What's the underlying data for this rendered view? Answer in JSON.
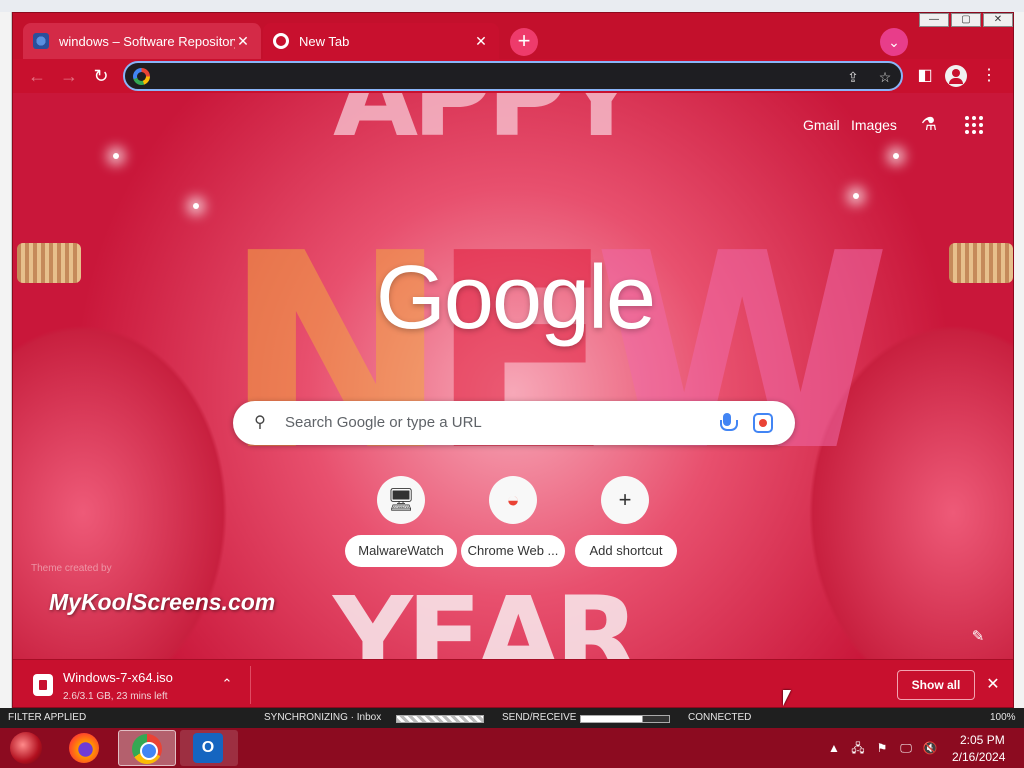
{
  "browser": {
    "tabs": [
      {
        "title": "windows – Software Repository",
        "close": "✕"
      },
      {
        "title": "New Tab",
        "close": "✕"
      }
    ],
    "new_tab_symbol": "+",
    "tab_search_symbol": "⌄",
    "window_controls": {
      "minimize": "—",
      "maximize": "▢",
      "close": "✕"
    },
    "toolbar": {
      "back": "←",
      "forward": "→",
      "reload": "↻",
      "address_value": "",
      "share_icon": "⇪",
      "bookmark_icon": "☆",
      "side_panel_icon": "◧",
      "menu_icon": "⋮"
    }
  },
  "ntp": {
    "top_links": {
      "gmail": "Gmail",
      "images": "Images"
    },
    "labs_icon": "⚗",
    "logo": "Google",
    "search_placeholder": "Search Google or type a URL",
    "search_icon": "⚲",
    "shortcuts": [
      {
        "label": "MalwareWatch",
        "icon": "🖥"
      },
      {
        "label": "Chrome Web ...",
        "icon": "◒"
      },
      {
        "label": "Add shortcut",
        "icon": "+"
      }
    ],
    "background_art": {
      "top": "APPY",
      "middle": [
        "N",
        "E",
        "W"
      ],
      "bottom": "YEAR"
    },
    "attribution": "Theme created by",
    "watermark": "MyKoolScreens.com",
    "customize_icon": "✎"
  },
  "download": {
    "file_name": "Windows-7-x64.iso",
    "status": "2.6/3.1 GB, 23 mins left",
    "chevron": "⌃",
    "show_all": "Show all",
    "close": "✕"
  },
  "outlook_status": {
    "filter": "FILTER APPLIED",
    "sync": "SYNCHRONIZING · Inbox",
    "send_receive": "SEND/RECEIVE",
    "connection": "CONNECTED",
    "zoom": "100%"
  },
  "taskbar": {
    "time": "2:05 PM",
    "date": "2/16/2024",
    "outlook_icon_letter": "O",
    "tray": {
      "chevron": "▲",
      "network": "🖧",
      "flag": "⚑",
      "monitor": "🖵",
      "volume": "🔇"
    }
  }
}
